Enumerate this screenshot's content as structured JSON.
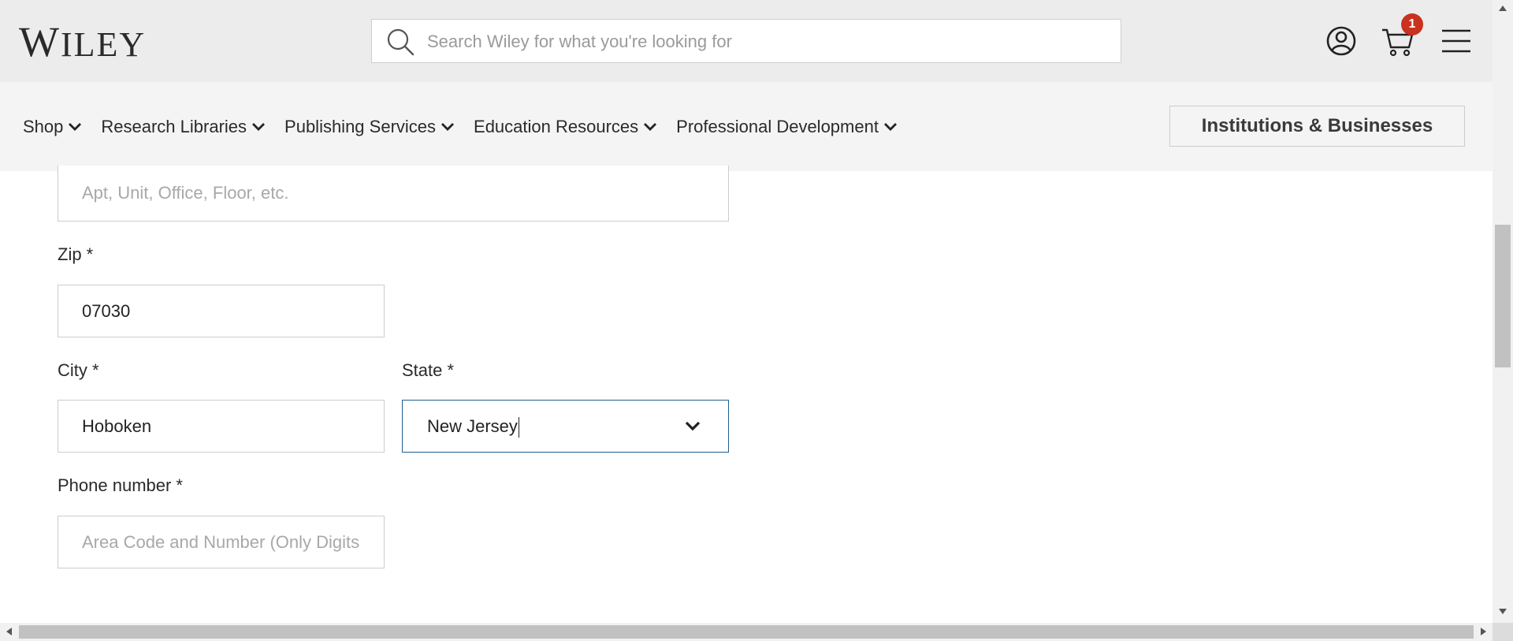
{
  "header": {
    "logo": "WILEY",
    "search_placeholder": "Search Wiley for what you're looking for",
    "cart_count": "1"
  },
  "nav": {
    "items": [
      {
        "label": "Shop"
      },
      {
        "label": "Research Libraries"
      },
      {
        "label": "Publishing Services"
      },
      {
        "label": "Education Resources"
      },
      {
        "label": "Professional Development"
      }
    ],
    "institutions_button": "Institutions & Businesses"
  },
  "form": {
    "address2": {
      "placeholder": "Apt, Unit, Office, Floor, etc.",
      "value": ""
    },
    "zip": {
      "label": "Zip *",
      "value": "07030"
    },
    "city": {
      "label": "City *",
      "value": "Hoboken"
    },
    "state": {
      "label": "State *",
      "value": "New Jersey"
    },
    "phone": {
      "label": "Phone number *",
      "placeholder": "Area Code and Number (Only Digits",
      "value": ""
    }
  },
  "colors": {
    "header_bg": "#ececec",
    "nav_bg": "#f4f4f4",
    "badge": "#c8321e",
    "focus_border": "#1f5f8f"
  }
}
